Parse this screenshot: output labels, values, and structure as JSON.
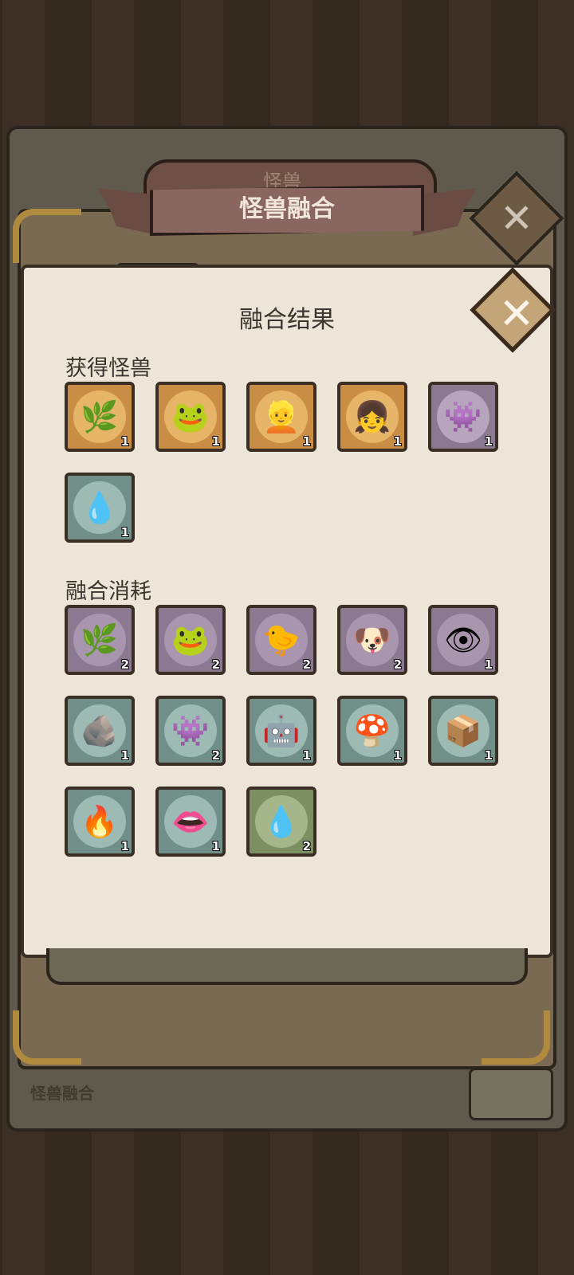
{
  "background_label": "怪兽融合",
  "back_ribbon_title": "怪兽",
  "header": {
    "title": "怪兽融合"
  },
  "dialog": {
    "title": "融合结果",
    "obtained": {
      "label": "获得怪兽",
      "items": [
        {
          "icon": "flytrap-monster-icon",
          "glyph": "🌿",
          "count": "1",
          "frame": "#c98d45",
          "bg": "#e7b568"
        },
        {
          "icon": "toad-monster-icon",
          "glyph": "🐸",
          "count": "1",
          "frame": "#c98d45",
          "bg": "#e7b568"
        },
        {
          "icon": "blonde-hero-icon",
          "glyph": "👱",
          "count": "1",
          "frame": "#c98d45",
          "bg": "#e7b568"
        },
        {
          "icon": "girl-hero-icon",
          "glyph": "👧",
          "count": "1",
          "frame": "#c98d45",
          "bg": "#e7b568"
        },
        {
          "icon": "coral-slug-monster-icon",
          "glyph": "👾",
          "count": "1",
          "frame": "#8b7891",
          "bg": "#b7a4bd"
        },
        {
          "icon": "blue-slime-icon",
          "glyph": "💧",
          "count": "1",
          "frame": "#6f8f88",
          "bg": "#9dbab4"
        }
      ]
    },
    "consumed": {
      "label": "融合消耗",
      "items": [
        {
          "icon": "flytrap-monster-icon",
          "glyph": "🌿",
          "count": "2",
          "frame": "#8b7891",
          "bg": "#a995ae"
        },
        {
          "icon": "toad-monster-icon",
          "glyph": "🐸",
          "count": "2",
          "frame": "#8b7891",
          "bg": "#a995ae"
        },
        {
          "icon": "yellow-chick-icon",
          "glyph": "🐤",
          "count": "2",
          "frame": "#8b7891",
          "bg": "#a995ae"
        },
        {
          "icon": "dog-monster-icon",
          "glyph": "🐶",
          "count": "2",
          "frame": "#8b7891",
          "bg": "#a995ae"
        },
        {
          "icon": "crystal-eye-monster-icon",
          "glyph": "👁",
          "count": "1",
          "frame": "#8b7891",
          "bg": "#a995ae"
        },
        {
          "icon": "rock-golem-icon",
          "glyph": "🪨",
          "count": "1",
          "frame": "#6f8f88",
          "bg": "#9dbab4"
        },
        {
          "icon": "coral-slug-monster-icon",
          "glyph": "👾",
          "count": "2",
          "frame": "#6f8f88",
          "bg": "#9dbab4"
        },
        {
          "icon": "robot-monster-icon",
          "glyph": "🤖",
          "count": "1",
          "frame": "#6f8f88",
          "bg": "#9dbab4"
        },
        {
          "icon": "mushroom-monster-icon",
          "glyph": "🍄",
          "count": "1",
          "frame": "#6f8f88",
          "bg": "#9dbab4"
        },
        {
          "icon": "mimic-chest-icon",
          "glyph": "📦",
          "count": "1",
          "frame": "#6f8f88",
          "bg": "#9dbab4"
        },
        {
          "icon": "fire-rock-monster-icon",
          "glyph": "🔥",
          "count": "1",
          "frame": "#6f8f88",
          "bg": "#9dbab4"
        },
        {
          "icon": "teeth-monster-icon",
          "glyph": "👄",
          "count": "1",
          "frame": "#6f8f88",
          "bg": "#9dbab4"
        },
        {
          "icon": "blue-slime-icon",
          "glyph": "💧",
          "count": "2",
          "frame": "#7c8f62",
          "bg": "#a5b78a"
        }
      ]
    }
  }
}
